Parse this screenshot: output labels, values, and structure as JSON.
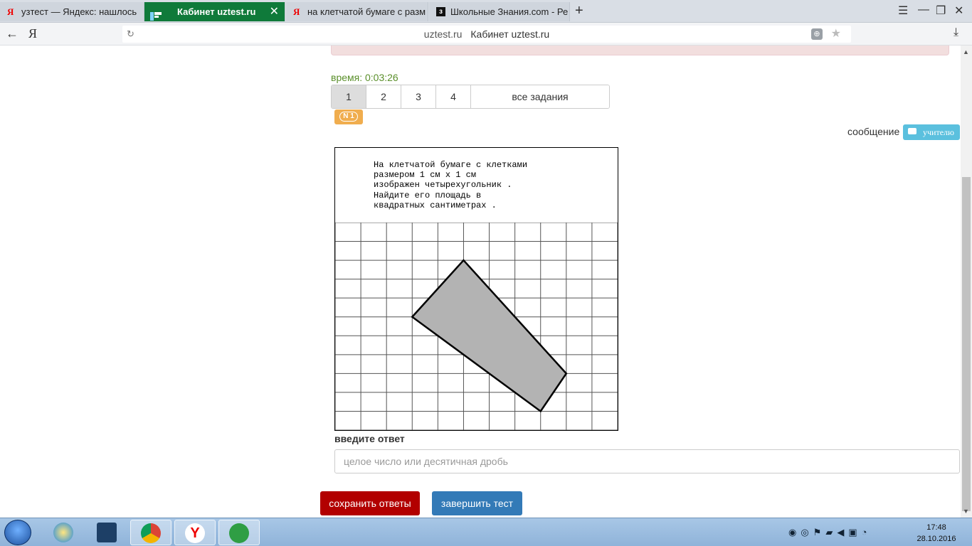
{
  "browser": {
    "tabs": [
      {
        "label": "узтест — Яндекс: нашлось",
        "active": false
      },
      {
        "label": "Кабинет uztest.ru",
        "active": true
      },
      {
        "label": "на клетчатой бумаге с разм",
        "active": false
      },
      {
        "label": "Школьные Знания.com - Ре",
        "active": false
      }
    ],
    "tab_close": "✕",
    "new_tab": "+",
    "address": {
      "host": "uztest.ru",
      "title": "Кабинет uztest.ru"
    },
    "yandex_logo": "Я"
  },
  "page": {
    "timer": "время: 0:03:26",
    "pages": [
      "1",
      "2",
      "3",
      "4"
    ],
    "active_page": "1",
    "all_tasks": "все задания",
    "task_badge": "N 1",
    "message_label": "сообщение",
    "teacher_button": "учителю",
    "task_text": "На клетчатой бумаге с клетками\nразмером 1 см х 1 см\nизображен четырехугольник .\nНайдите его площадь в\nквадратных сантиметрах .",
    "answer_label": "введите ответ",
    "answer_placeholder": "целое число или десятичная дробь",
    "answer_value": "",
    "save_button": "сохранить ответы",
    "finish_button": "завершить тест"
  },
  "figure": {
    "grid_columns": 11,
    "grid_rows": 11,
    "polygon_vertices": [
      [
        5,
        2
      ],
      [
        3,
        5
      ],
      [
        8,
        10
      ],
      [
        9,
        8
      ]
    ],
    "fill_color": "#b3b3b3"
  },
  "taskbar": {
    "time": "17:48",
    "date": "28.10.2016",
    "pinned": [
      "windows-start",
      "internet-explorer",
      "kmplayer",
      "chrome",
      "yandex-browser",
      "utorrent"
    ]
  },
  "colors": {
    "timer": "#5a8f2a",
    "save_button": "#b20000",
    "finish_button": "#337ab7",
    "badge": "#f0ad4e",
    "teacher_button": "#5bc0de",
    "active_tab": "#0f7a3a"
  }
}
